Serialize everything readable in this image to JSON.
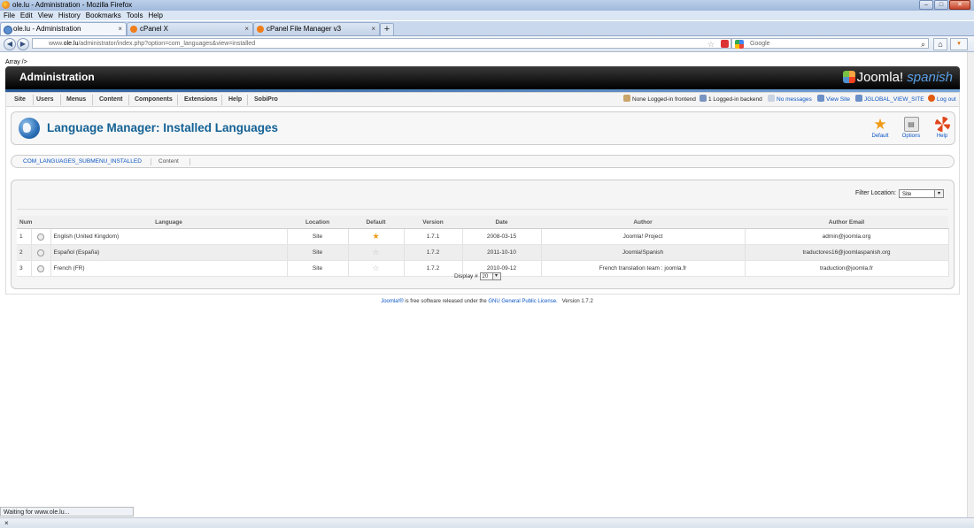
{
  "browser": {
    "window_title": "ole.lu - Administration - Mozilla Firefox",
    "menu": [
      "File",
      "Edit",
      "View",
      "History",
      "Bookmarks",
      "Tools",
      "Help"
    ],
    "tabs": [
      {
        "label": "ole.lu - Administration",
        "active": true
      },
      {
        "label": "cPanel X",
        "active": false
      },
      {
        "label": "cPanel File Manager v3",
        "active": false
      }
    ],
    "url_prefix": "www.",
    "url_domain": "ole.lu",
    "url_rest": "/administrator/index.php?option=com_languages&view=installed",
    "search_placeholder": "Google",
    "status": "Waiting for www.ole.lu...",
    "close_glyph": "×"
  },
  "page": {
    "debug_text": "Array />",
    "header": {
      "title": "Administration",
      "logo_word": "Joomla!",
      "logo_suffix": "spanish"
    },
    "menu": [
      "Site",
      "Users",
      "Menus",
      "Content",
      "Components",
      "Extensions",
      "Help",
      "SobiPro"
    ],
    "status_items": [
      {
        "text": "None Logged-in frontend",
        "link": false
      },
      {
        "text": "1 Logged-in backend",
        "link": false
      },
      {
        "text": "No messages",
        "link": true
      },
      {
        "text": "View Site",
        "link": true
      },
      {
        "text": "JGLOBAL_VIEW_SITE",
        "link": true
      },
      {
        "text": "Log out",
        "link": true
      }
    ],
    "title": "Language Manager: Installed Languages",
    "toolbar": [
      {
        "label": "Default",
        "icon": "star-icon"
      },
      {
        "label": "Options",
        "icon": "options-icon"
      },
      {
        "label": "Help",
        "icon": "help-icon"
      }
    ],
    "submenu": [
      {
        "label": "COM_LANGUAGES_SUBMENU_INSTALLED",
        "active": true
      },
      {
        "label": "Content",
        "active": false
      }
    ],
    "filter": {
      "label": "Filter Location:",
      "value": "Site"
    },
    "table": {
      "columns": [
        "Num",
        "",
        "Language",
        "Location",
        "Default",
        "Version",
        "Date",
        "Author",
        "Author Email"
      ],
      "rows": [
        {
          "num": "1",
          "language": "English (United Kingdom)",
          "location": "Site",
          "default": true,
          "version": "1.7.1",
          "date": "2008-03-15",
          "author": "Joomla! Project",
          "email": "admin@joomla.org"
        },
        {
          "num": "2",
          "language": "Español (España)",
          "location": "Site",
          "default": false,
          "version": "1.7.2",
          "date": "2011-10-10",
          "author": "Joomla!Spanish",
          "email": "traductores16@joomlaspanish.org"
        },
        {
          "num": "3",
          "language": "French (FR)",
          "location": "Site",
          "default": false,
          "version": "1.7.2",
          "date": "2010-09-12",
          "author": "French translation team : joomla.fr",
          "email": "traduction@joomla.fr"
        }
      ]
    },
    "pager": {
      "label": "Display #",
      "value": "20"
    },
    "footer": {
      "joomla_link": "Joomla!®",
      "text1": " is free software released under the ",
      "license_link": "GNU General Public License.",
      "version": "Version 1.7.2"
    }
  },
  "colors": {
    "link": "#0b55c4",
    "title": "#146295",
    "header_bg": "#111111",
    "default_star": "#f19a16"
  }
}
